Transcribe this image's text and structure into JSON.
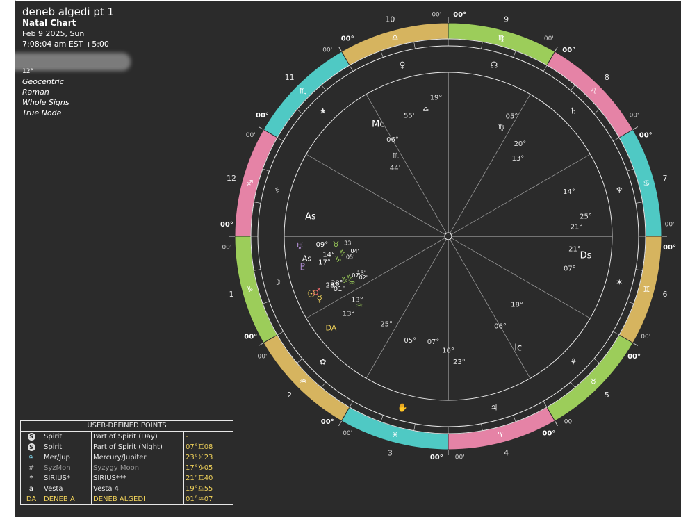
{
  "header": {
    "title": "deneb algedi pt 1",
    "chart_type": "Natal Chart",
    "date": "Feb 9 2025, Sun",
    "time": "7:08:04 am  EST +5:00",
    "hidden_line": "12°",
    "settings": [
      "Geocentric",
      "Raman",
      "Whole Signs",
      "True Node"
    ]
  },
  "house_numbers": [
    "1",
    "2",
    "3",
    "4",
    "5",
    "6",
    "7",
    "8",
    "9",
    "10",
    "11",
    "12"
  ],
  "cusp_label_major": "00°",
  "cusp_label_minor": "00'",
  "zodiac_ring": {
    "colors": [
      "#4fc9c4",
      "#e583a6",
      "#9ccd5a",
      "#d6b45f"
    ],
    "glyphs": [
      "♈",
      "♉",
      "♊",
      "♋",
      "♌",
      "♍",
      "♎",
      "♏",
      "♐",
      "♑",
      "♒",
      "♓"
    ]
  },
  "angles": {
    "asc": "As",
    "mc": "Mc",
    "dsc": "Ds",
    "ic": "Ic"
  },
  "planets": [
    {
      "glyph": "♅",
      "deg": "09°",
      "sign": "♉",
      "min": "33'",
      "color": "#b490d8",
      "lon": 129
    },
    {
      "glyph": "As",
      "deg": "14°",
      "sign": "♑",
      "min": "04'",
      "color": "#ffffff",
      "lon": 134
    },
    {
      "glyph": "♇",
      "deg": "17°",
      "sign": "♑",
      "min": "05'",
      "color": "#b490d8",
      "lon": 137
    },
    {
      "glyph": "♂",
      "deg": "28°",
      "sign": "♑",
      "min": "13'",
      "color": "#e06666",
      "lon": 148
    },
    {
      "glyph": "☉",
      "deg": "28°",
      "sign": "♑",
      "min": "07'",
      "color": "#f0d25a",
      "lon": 148
    },
    {
      "glyph": "☿",
      "deg": "01°",
      "sign": "♒",
      "min": "02'",
      "color": "#f0d25a",
      "lon": 151
    },
    {
      "glyph": "DA",
      "deg": "13°",
      "sign": "♒",
      "min": "",
      "color": "#f0d25a",
      "lon": 163
    }
  ],
  "udp_table": {
    "title": "USER-DEFINED POINTS",
    "rows": [
      {
        "icon": "S",
        "short": "Spirit",
        "name": "Part of Spirit (Day)",
        "pos": "-"
      },
      {
        "icon": "S",
        "short": "Spirit",
        "name": "Part of Spirit (Night)",
        "pos": "07°♊08"
      },
      {
        "icon": "♃",
        "short": "Mer/Jup",
        "name": "Mercury/Jupiter",
        "pos": "23°♓23"
      },
      {
        "icon": "#",
        "short": "SyzMon",
        "name": "Syzygy Moon",
        "pos": "17°♑05"
      },
      {
        "icon": "*",
        "short": "SIRIUS*",
        "name": "SIRIUS***",
        "pos": "21°♊40"
      },
      {
        "icon": "a",
        "short": "Vesta",
        "name": "Vesta 4",
        "pos": "19°♎55"
      },
      {
        "icon": "DA",
        "short": "DENEB A",
        "name": "DENEB ALGEDI",
        "pos": "01°♒07"
      }
    ]
  }
}
